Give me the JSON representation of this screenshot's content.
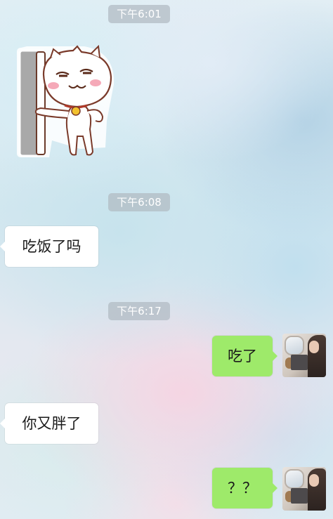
{
  "messages": [
    {
      "type": "time",
      "text": "下午6:01"
    },
    {
      "type": "sticker",
      "side": "left",
      "sticker": "cat-leaning-on-door-icon"
    },
    {
      "type": "time",
      "text": "下午6:08"
    },
    {
      "type": "text",
      "side": "left",
      "text": "吃饭了吗"
    },
    {
      "type": "time",
      "text": "下午6:17"
    },
    {
      "type": "text",
      "side": "right",
      "text": "吃了"
    },
    {
      "type": "text",
      "side": "left",
      "text": "你又胖了"
    },
    {
      "type": "text",
      "side": "right",
      "text": "？？"
    }
  ],
  "colors": {
    "outgoing_bubble": "#9eea6a",
    "incoming_bubble": "#ffffff",
    "timestamp_background": "#b0bac2"
  }
}
